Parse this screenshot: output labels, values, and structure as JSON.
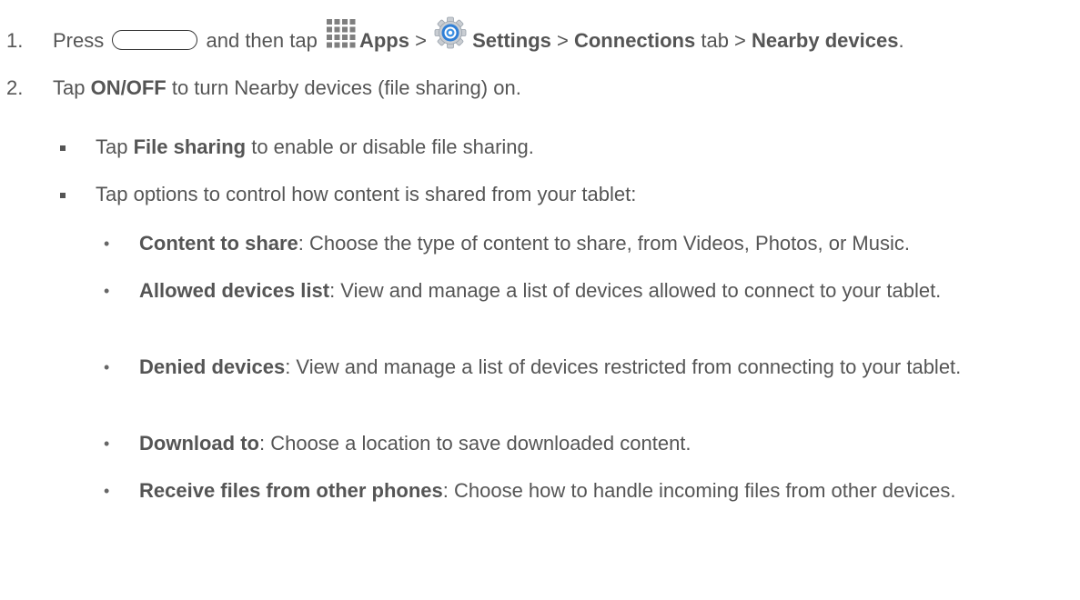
{
  "steps": [
    {
      "number": "1.",
      "press": "Press",
      "and_then_tap": "and then tap",
      "apps": "Apps",
      "gt1": ">",
      "settings": "Settings",
      "gt2": ">",
      "connections": "Connections",
      "tab": "tab >",
      "nearby_devices": "Nearby devices",
      "period": "."
    },
    {
      "number": "2.",
      "tap": "Tap",
      "on_off": "ON/OFF",
      "rest": "to turn Nearby devices (file sharing) on."
    }
  ],
  "sub_bullets": [
    {
      "tap": "Tap",
      "bold": "File sharing",
      "rest": "to enable or disable file sharing."
    },
    {
      "text": "Tap options to control how content is shared from your tablet:"
    }
  ],
  "options": [
    {
      "term": "Content to share",
      "desc": ": Choose the type of content to share, from Videos, Photos, or Music."
    },
    {
      "term": "Allowed devices list",
      "desc": ": View and manage a list of devices allowed to connect to your tablet."
    },
    {
      "term": "Denied devices",
      "desc": ": View and manage a list of devices restricted from connecting to your tablet."
    },
    {
      "term": "Download to",
      "desc": ": Choose a location to save downloaded content."
    },
    {
      "term": "Receive files from other phones",
      "desc": ": Choose how to handle incoming files from other devices."
    }
  ],
  "icons": {
    "home_button": "home-key-icon",
    "apps": "apps-grid-icon",
    "settings": "settings-gear-icon"
  },
  "colors": {
    "text": "#555555",
    "apps_icon": "#7f7f7f",
    "gear_blue": "#2f7fd6"
  }
}
